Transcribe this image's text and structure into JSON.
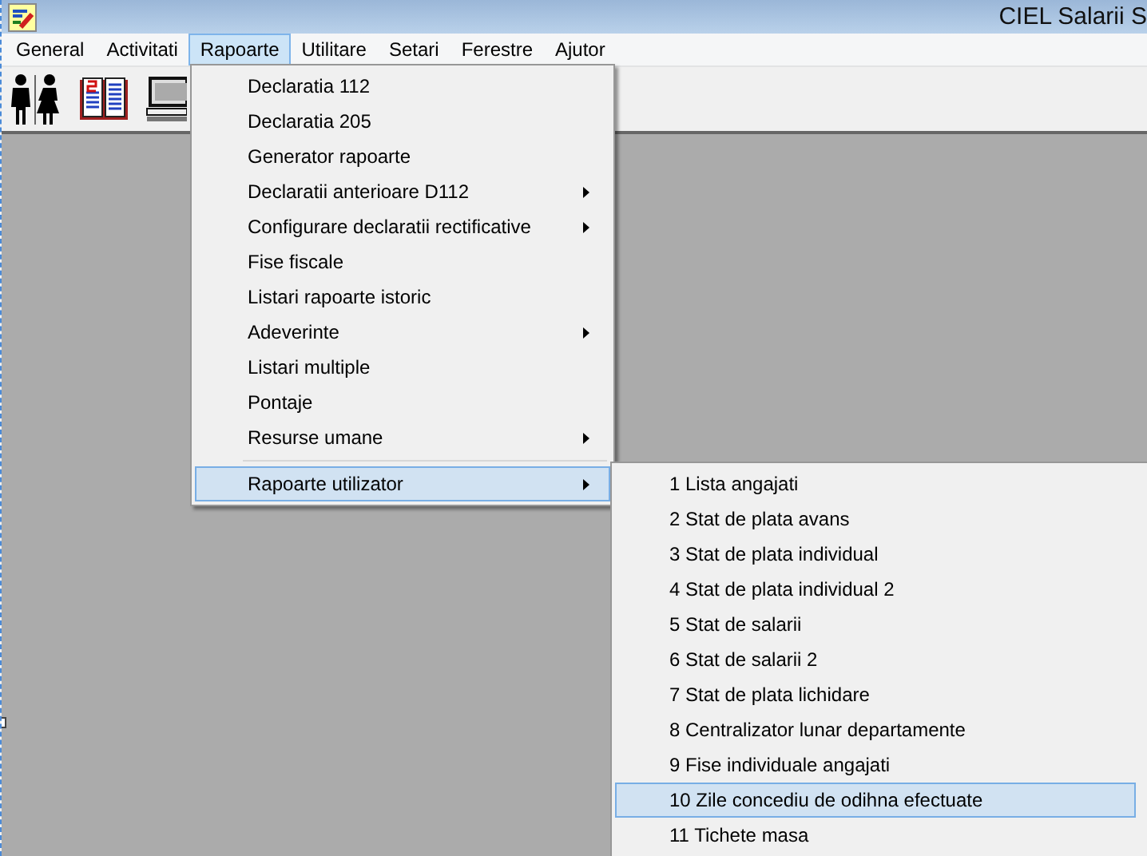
{
  "window": {
    "title": "CIEL Salarii S"
  },
  "menubar": [
    {
      "label": "General",
      "selected": false
    },
    {
      "label": "Activitati",
      "selected": false
    },
    {
      "label": "Rapoarte",
      "selected": true
    },
    {
      "label": "Utilitare",
      "selected": false
    },
    {
      "label": "Setari",
      "selected": false
    },
    {
      "label": "Ferestre",
      "selected": false
    },
    {
      "label": "Ajutor",
      "selected": false
    }
  ],
  "menu": {
    "items": [
      {
        "label": "Declaratia 112",
        "submenu": false,
        "selected": false
      },
      {
        "label": "Declaratia 205",
        "submenu": false,
        "selected": false
      },
      {
        "label": "Generator rapoarte",
        "submenu": false,
        "selected": false
      },
      {
        "label": "Declaratii anterioare D112",
        "submenu": true,
        "selected": false
      },
      {
        "label": "Configurare declaratii rectificative",
        "submenu": true,
        "selected": false
      },
      {
        "label": "Fise fiscale",
        "submenu": false,
        "selected": false
      },
      {
        "label": "Listari rapoarte istoric",
        "submenu": false,
        "selected": false
      },
      {
        "label": "Adeverinte",
        "submenu": true,
        "selected": false
      },
      {
        "label": "Listari multiple",
        "submenu": false,
        "selected": false
      },
      {
        "label": "Pontaje",
        "submenu": false,
        "selected": false
      },
      {
        "label": "Resurse umane",
        "submenu": true,
        "selected": false
      },
      {
        "kind": "separator"
      },
      {
        "label": "Rapoarte utilizator",
        "submenu": true,
        "selected": true
      }
    ]
  },
  "submenu": {
    "items": [
      {
        "label": "1 Lista angajati",
        "selected": false
      },
      {
        "label": "2 Stat de plata avans",
        "selected": false
      },
      {
        "label": "3 Stat de plata individual",
        "selected": false
      },
      {
        "label": "4 Stat de plata individual 2",
        "selected": false
      },
      {
        "label": "5 Stat de salarii",
        "selected": false
      },
      {
        "label": "6 Stat de salarii 2",
        "selected": false
      },
      {
        "label": "7 Stat de plata lichidare",
        "selected": false
      },
      {
        "label": "8 Centralizator lunar departamente",
        "selected": false
      },
      {
        "label": "9 Fise individuale angajati",
        "selected": false
      },
      {
        "label": "10 Zile concediu de odihna efectuate",
        "selected": true
      },
      {
        "label": "11 Tichete masa",
        "selected": false
      }
    ]
  }
}
